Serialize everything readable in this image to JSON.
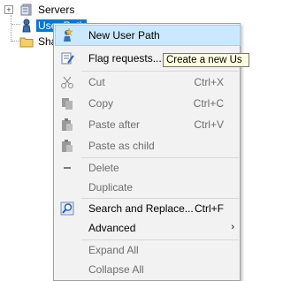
{
  "tree": {
    "expander": "+",
    "servers_label": "Servers",
    "user_label": "User Path",
    "share_label": "Shar"
  },
  "menu": {
    "new_user_path": "New User Path",
    "flag_requests": "Flag requests...",
    "cut": "Cut",
    "cut_sc": "Ctrl+X",
    "copy": "Copy",
    "copy_sc": "Ctrl+C",
    "paste_after": "Paste after",
    "paste_after_sc": "Ctrl+V",
    "paste_child": "Paste as child",
    "delete": "Delete",
    "duplicate": "Duplicate",
    "search_replace": "Search and Replace...",
    "search_replace_sc": "Ctrl+F",
    "advanced": "Advanced",
    "expand_all": "Expand All",
    "collapse_all": "Collapse All",
    "submenu_arrow": "›"
  },
  "tooltip": "Create a new Us",
  "colors": {
    "selection": "#0078d7",
    "highlight": "#cce8ff",
    "disabled": "#6d6d6d"
  }
}
